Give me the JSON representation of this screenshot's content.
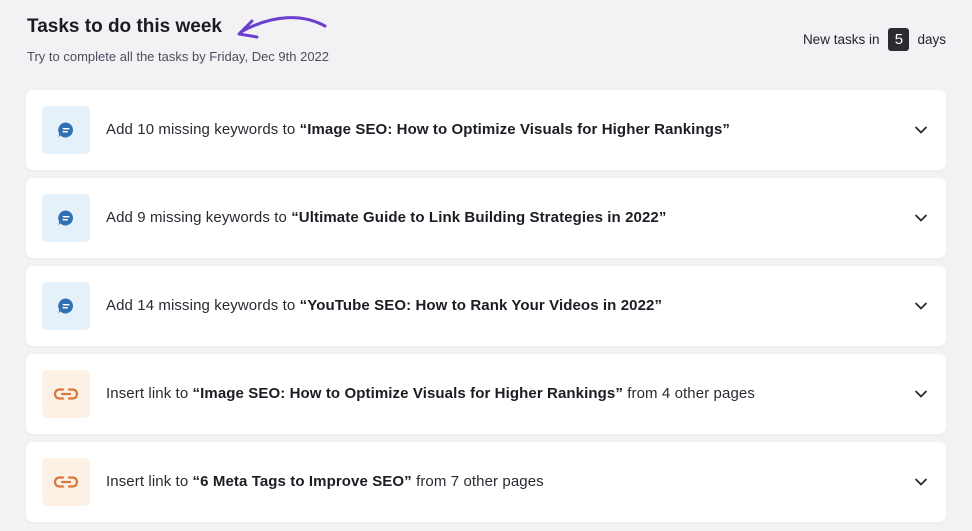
{
  "header": {
    "title": "Tasks to do this week",
    "subtitle": "Try to complete all the tasks by Friday, Dec 9th 2022",
    "countdown_prefix": "New tasks in",
    "countdown_days": "5",
    "countdown_suffix": "days"
  },
  "tasks": [
    {
      "icon": "message-icon",
      "prefix": "Add 10 missing keywords to ",
      "target": "“Image SEO: How to Optimize Visuals for Higher Rankings”",
      "suffix": ""
    },
    {
      "icon": "message-icon",
      "prefix": "Add 9 missing keywords to ",
      "target": "“Ultimate Guide to Link Building Strategies in 2022”",
      "suffix": ""
    },
    {
      "icon": "message-icon",
      "prefix": "Add 14 missing keywords to ",
      "target": "“YouTube SEO: How to Rank Your Videos in 2022”",
      "suffix": ""
    },
    {
      "icon": "link-icon",
      "prefix": "Insert link to ",
      "target": "“Image SEO: How to Optimize Visuals for Higher Rankings”",
      "suffix": " from 4 other pages"
    },
    {
      "icon": "link-icon",
      "prefix": "Insert link to ",
      "target": "“6 Meta Tags to Improve SEO”",
      "suffix": " from 7 other pages"
    }
  ],
  "colors": {
    "arrow": "#6a3fd0",
    "keyword_icon": "#2e6fb5",
    "keyword_icon_bg": "#e4f1fb",
    "link_icon": "#d9783a",
    "link_icon_bg": "#fdf1e6"
  }
}
